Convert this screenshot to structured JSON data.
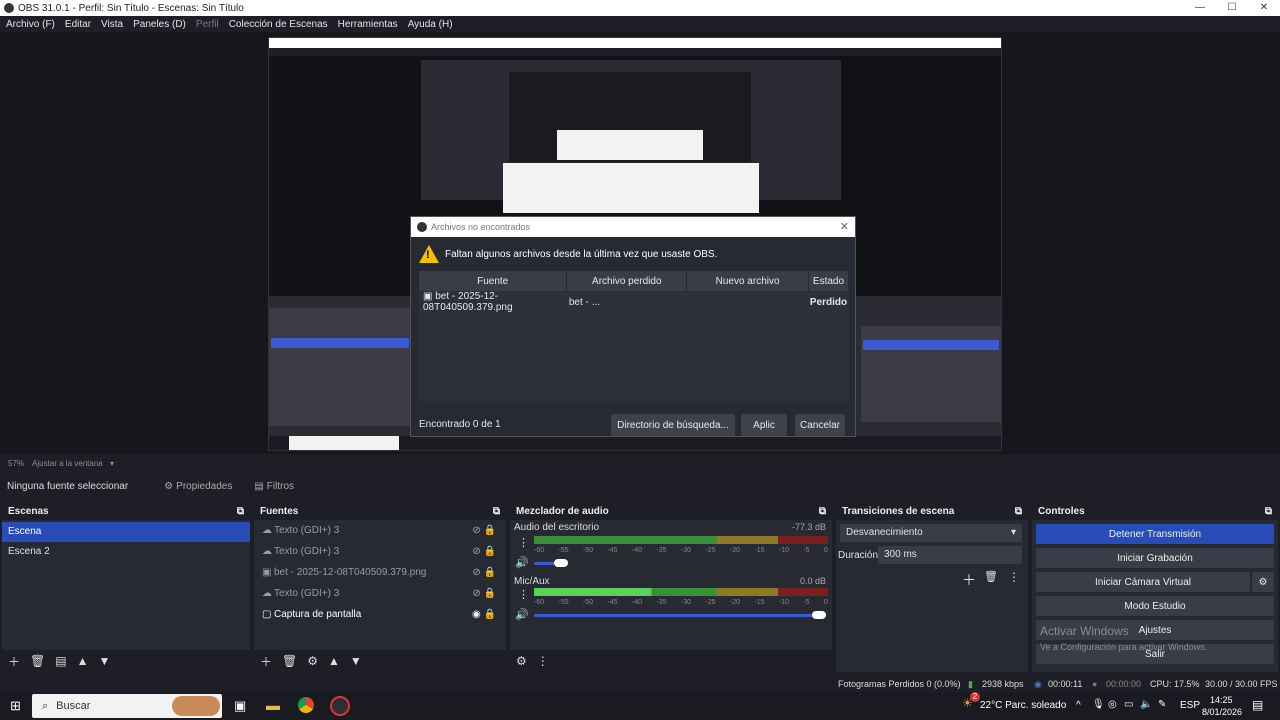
{
  "window": {
    "title": "OBS 31.0.1 - Perfil: Sin Título - Escenas: Sin Título"
  },
  "menu": {
    "items": [
      "Archivo (F)",
      "Editar",
      "Vista",
      "Paneles (D)",
      "Perfil",
      "Colección de Escenas",
      "Herramientas",
      "Ayuda (H)"
    ]
  },
  "dialog": {
    "title": "Archivos no encontrados",
    "message": "Faltan algunos archivos desde la última vez que usaste OBS.",
    "columns": [
      "Fuente",
      "Archivo perdido",
      "Nuevo archivo",
      "Estado"
    ],
    "row": {
      "source": "bet - 2025-12-08T040509.379.png",
      "lost": "bet - ...",
      "new": "",
      "status": "Perdido"
    },
    "found": "Encontrado 0 de 1",
    "btn_dir": "Directorio de búsqueda...",
    "btn_apply": "Aplic",
    "btn_cancel": "Cancelar"
  },
  "zoom": {
    "level": "57%",
    "fit": "Ajustar a la ventana"
  },
  "sourcebar": {
    "none": "Ninguna fuente seleccionar",
    "props": "Propiedades",
    "filters": "Filtros"
  },
  "scenes": {
    "title": "Escenas",
    "items": [
      "Escena",
      "Escena 2"
    ]
  },
  "sources": {
    "title": "Fuentes",
    "items": [
      "Texto (GDI+) 3",
      "Texto (GDI+) 3",
      "bet - 2025-12-08T040509.379.png",
      "Texto (GDI+) 3",
      "Captura de pantalla"
    ]
  },
  "mixer": {
    "title": "Mezclador de audio",
    "ch1": {
      "name": "Audio del escritorio",
      "db": "-77.3 dB"
    },
    "ch2": {
      "name": "Mic/Aux",
      "db": "0.0 dB"
    },
    "ticks": [
      "-60",
      "-55",
      "-50",
      "-45",
      "-40",
      "-35",
      "-30",
      "-25",
      "-20",
      "-15",
      "-10",
      "-5",
      "0"
    ]
  },
  "transitions": {
    "title": "Transiciones de escena",
    "selected": "Desvanecimiento",
    "duration_label": "Duración",
    "duration": "300 ms"
  },
  "controls": {
    "title": "Controles",
    "stop_stream": "Detener Transmisión",
    "start_rec": "Iniciar Grabación",
    "virtual_cam": "Iniciar Cámara Virtual",
    "studio": "Modo Estudio",
    "settings": "Ajustes",
    "exit": "Salir",
    "watermark1": "Activar Windows",
    "watermark2": "Ve a Configuración para activar Windows."
  },
  "status": {
    "dropped": "Fotogramas Perdidos 0 (0.0%)",
    "bitrate": "2938 kbps",
    "live": "00:00:11",
    "rec": "00:00:00",
    "cpu": "CPU: 17.5%",
    "fps": "30.00 / 30.00 FPS"
  },
  "taskbar": {
    "search": "Buscar",
    "weather": "22°C  Parc. soleado",
    "lang": "ESP",
    "time": "14:25",
    "date": "8/01/2026",
    "badge": "2"
  }
}
